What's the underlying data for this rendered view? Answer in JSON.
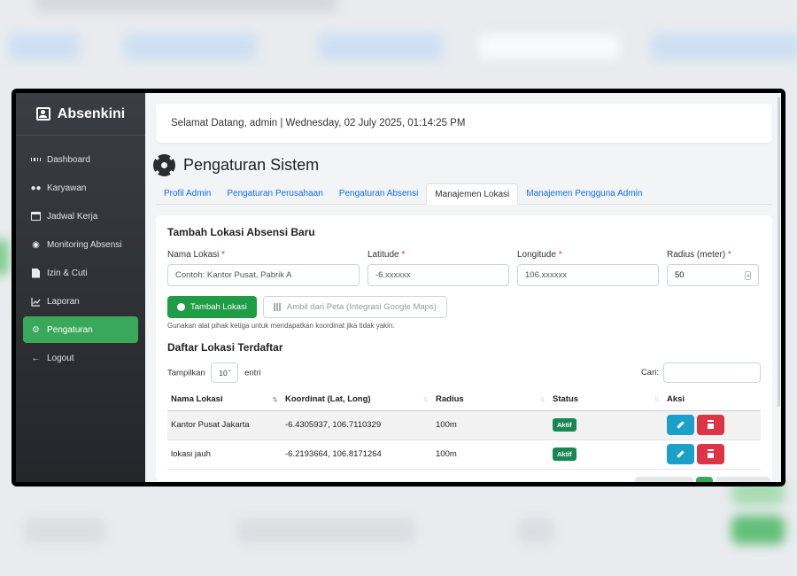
{
  "app": {
    "brand": "Absenkini"
  },
  "sidebar": {
    "items": [
      {
        "label": "Dashboard",
        "icon": "dashboard-icon",
        "active": false
      },
      {
        "label": "Karyawan",
        "icon": "users-icon",
        "active": false
      },
      {
        "label": "Jadwal Kerja",
        "icon": "calendar-icon",
        "active": false
      },
      {
        "label": "Monitoring Absensi",
        "icon": "eye-icon",
        "active": false
      },
      {
        "label": "Izin & Cuti",
        "icon": "file-icon",
        "active": false
      },
      {
        "label": "Laporan",
        "icon": "chart-line-icon",
        "active": false
      },
      {
        "label": "Pengaturan",
        "icon": "gear-icon",
        "active": true
      },
      {
        "label": "Logout",
        "icon": "logout-arrow-icon",
        "active": false
      }
    ]
  },
  "header": {
    "welcome": "Selamat Datang, admin | Wednesday, 02 July 2025, 01:14:25 PM"
  },
  "page": {
    "title": "Pengaturan Sistem"
  },
  "tabs": [
    {
      "label": "Profil Admin",
      "active": false
    },
    {
      "label": "Pengaturan Perusahaan",
      "active": false
    },
    {
      "label": "Pengaturan Absensi",
      "active": false
    },
    {
      "label": "Manajemen Lokasi",
      "active": true
    },
    {
      "label": "Manajemen Pengguna Admin",
      "active": false
    }
  ],
  "form": {
    "title": "Tambah Lokasi Absensi Baru",
    "fields": {
      "nama": {
        "label": "Nama Lokasi",
        "placeholder": "Contoh: Kantor Pusat, Pabrik A"
      },
      "lat": {
        "label": "Latitude",
        "placeholder": "-6.xxxxxx"
      },
      "lng": {
        "label": "Longitude",
        "placeholder": "106.xxxxxx"
      },
      "radius": {
        "label": "Radius (meter)",
        "value": "50"
      }
    },
    "required_mark": "*",
    "add_button": "Tambah Lokasi",
    "map_button": "Ambil dari Peta (Integrasi Google Maps)",
    "hint": "Gunakan alat pihak ketiga untuk mendapatkan koordinat jika tidak yakin."
  },
  "list": {
    "title": "Daftar Lokasi Terdaftar",
    "show_label": "Tampilkan",
    "page_length": "10",
    "entries_label": "entri",
    "search_label": "Cari:",
    "columns": [
      "Nama Lokasi",
      "Koordinat (Lat, Long)",
      "Radius",
      "Status",
      "Aksi"
    ],
    "rows": [
      {
        "nama": "Kantor Pusat Jakarta",
        "koordinat": "-6.4305937, 106.7110329",
        "radius": "100m",
        "status": "Aktif"
      },
      {
        "nama": "lokasi jauh",
        "koordinat": "-6.2193664, 106.8171264",
        "radius": "100m",
        "status": "Aktif"
      }
    ]
  },
  "colors": {
    "accent": "#3aa85a",
    "primary": "#0d6efd",
    "danger": "#dc3545",
    "info": "#1aa0c9"
  }
}
